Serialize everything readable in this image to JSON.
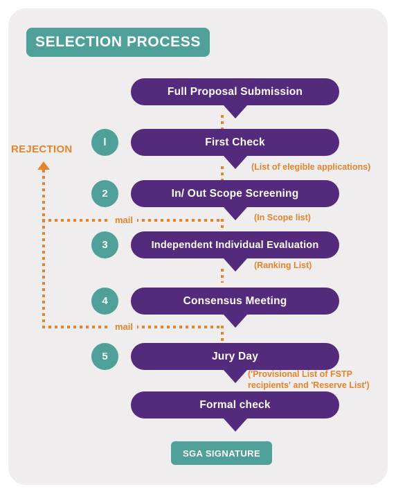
{
  "colors": {
    "purple": "#542a7c",
    "teal": "#4fa099",
    "orange": "#e4842d",
    "card_bg": "#efeded",
    "page_bg": "#ffffff",
    "text_on_fill": "#ffffff"
  },
  "header": {
    "title": "SELECTION PROCESS"
  },
  "flow": {
    "steps": [
      {
        "number": "",
        "label": "Full Proposal Submission",
        "note": ""
      },
      {
        "number": "l",
        "label": "First Check",
        "note": "(List of elegible applications)"
      },
      {
        "number": "2",
        "label": "In/ Out Scope Screening",
        "note": "(In Scope list)"
      },
      {
        "number": "3",
        "label": "Independent Individual Evaluation",
        "note": "(Ranking List)"
      },
      {
        "number": "4",
        "label": "Consensus Meeting",
        "note": ""
      },
      {
        "number": "5",
        "label": "Jury Day",
        "note": "('Provisional List of FSTP recipients' and 'Reserve List')"
      },
      {
        "number": "",
        "label": "Formal check",
        "note": ""
      }
    ],
    "final": {
      "label": "SGA SIGNATURE"
    }
  },
  "rejection": {
    "label": "REJECTION",
    "mail_label_top": "mail",
    "mail_label_bottom": "mail"
  }
}
